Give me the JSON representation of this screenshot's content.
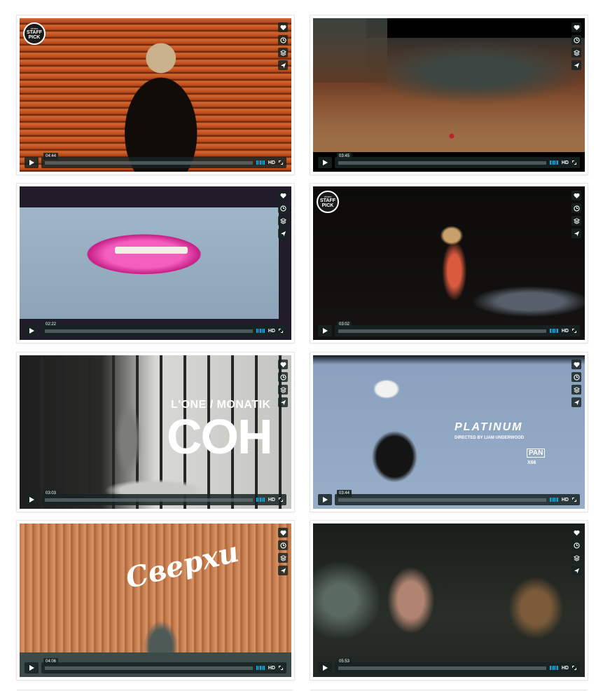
{
  "staff_pick": {
    "small": "vimeo",
    "line1": "STAFF",
    "line2": "PICK"
  },
  "player": {
    "hd_label": "HD"
  },
  "videos": [
    {
      "id": "v1",
      "time": "04:44",
      "staff_pick": true
    },
    {
      "id": "v2",
      "time": "03:45",
      "staff_pick": false
    },
    {
      "id": "v3",
      "time": "02:22",
      "staff_pick": false
    },
    {
      "id": "v4",
      "time": "03:02",
      "staff_pick": true
    },
    {
      "id": "v5",
      "time": "03:03",
      "staff_pick": false,
      "overlay": {
        "artist": "L'ONE / MONATIK",
        "title": "COH"
      }
    },
    {
      "id": "v6",
      "time": "03:44",
      "staff_pick": false,
      "overlay": {
        "title": "PLATINUM",
        "credit": "DIRECTED BY LIAM UNDERWOOD",
        "label1": "PAN",
        "label2": "X66"
      }
    },
    {
      "id": "v7",
      "time": "04:06",
      "staff_pick": false,
      "overlay": {
        "script": "Сверхи"
      }
    },
    {
      "id": "v8",
      "time": "05:53",
      "staff_pick": false
    }
  ],
  "icons": {
    "like": "heart-icon",
    "watch_later": "clock-icon",
    "collections": "layers-icon",
    "share": "paper-plane-icon",
    "play": "play-icon",
    "volume": "volume-icon",
    "fullscreen": "fullscreen-icon"
  },
  "colors": {
    "accent": "#00adef",
    "control_bg": "#172322"
  }
}
